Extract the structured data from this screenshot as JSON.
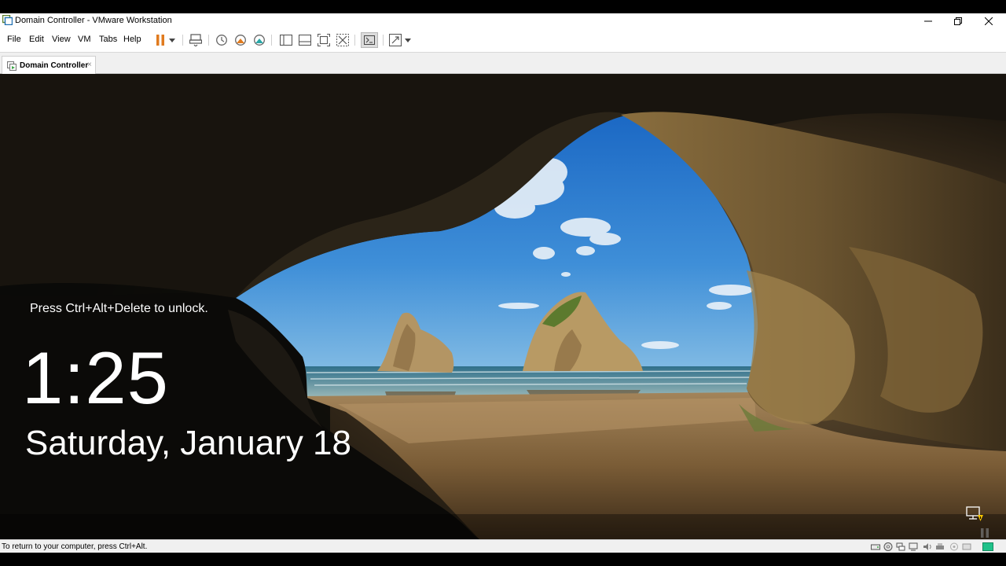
{
  "window": {
    "title": "Domain Controller - VMware Workstation"
  },
  "menubar": {
    "items": [
      {
        "label": "File"
      },
      {
        "label": "Edit"
      },
      {
        "label": "View"
      },
      {
        "label": "VM"
      },
      {
        "label": "Tabs"
      },
      {
        "label": "Help"
      }
    ],
    "toolbar_icons": [
      "pause-icon",
      "dropdown-icon",
      "send-ctrl-alt-del-icon",
      "snapshot-icon",
      "revert-snapshot-icon",
      "snapshot-manager-icon",
      "show-library-icon",
      "thumbnail-bar-icon",
      "full-screen-icon",
      "unity-icon",
      "console-view-icon",
      "stretch-guest-icon"
    ]
  },
  "tabs": [
    {
      "label": "Domain Controller",
      "close": "×"
    }
  ],
  "lockscreen": {
    "prompt": "Press Ctrl+Alt+Delete to unlock.",
    "time": "1:25",
    "date": "Saturday, January 18"
  },
  "statusbar": {
    "message": "To return to your computer, press Ctrl+Alt.",
    "device_icons": [
      "hard-disk-icon",
      "cd-dvd-icon",
      "network-adapter-icon",
      "usb-icon",
      "sound-icon",
      "printer-icon",
      "display-icon",
      "message-icon"
    ]
  },
  "colors": {
    "accent_pause": "#e07b1f",
    "titlebar": "#ffffff",
    "tabstrip": "#f0f0f0"
  }
}
